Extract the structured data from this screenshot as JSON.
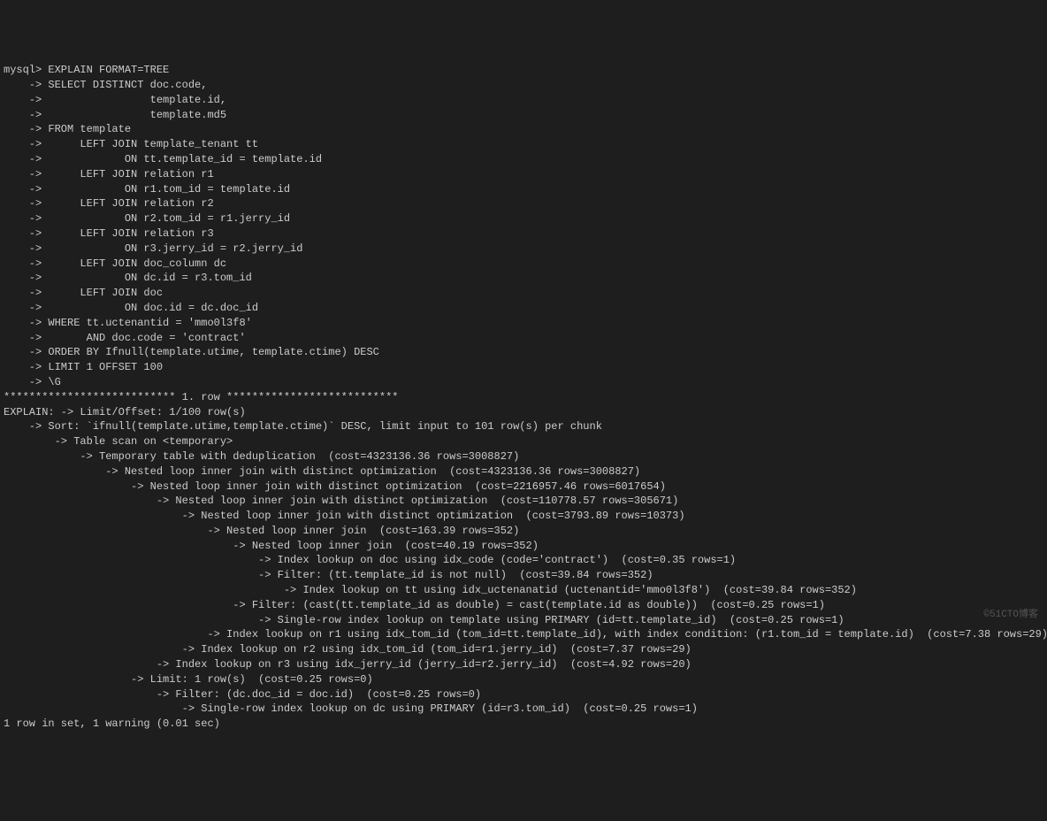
{
  "terminal": {
    "lines": [
      "mysql> EXPLAIN FORMAT=TREE",
      "    -> SELECT DISTINCT doc.code,",
      "    ->                 template.id,",
      "    ->                 template.md5",
      "    -> FROM template",
      "    ->      LEFT JOIN template_tenant tt",
      "    ->             ON tt.template_id = template.id",
      "    ->      LEFT JOIN relation r1",
      "    ->             ON r1.tom_id = template.id",
      "    ->      LEFT JOIN relation r2",
      "    ->             ON r2.tom_id = r1.jerry_id",
      "    ->      LEFT JOIN relation r3",
      "    ->             ON r3.jerry_id = r2.jerry_id",
      "    ->      LEFT JOIN doc_column dc",
      "    ->             ON dc.id = r3.tom_id",
      "    ->      LEFT JOIN doc",
      "    ->             ON doc.id = dc.doc_id",
      "    -> WHERE tt.uctenantid = 'mmo0l3f8'",
      "    ->       AND doc.code = 'contract'",
      "    -> ORDER BY Ifnull(template.utime, template.ctime) DESC",
      "    -> LIMIT 1 OFFSET 100",
      "    -> \\G",
      "*************************** 1. row ***************************",
      "EXPLAIN: -> Limit/Offset: 1/100 row(s)",
      "    -> Sort: `ifnull(template.utime,template.ctime)` DESC, limit input to 101 row(s) per chunk",
      "        -> Table scan on <temporary>",
      "            -> Temporary table with deduplication  (cost=4323136.36 rows=3008827)",
      "                -> Nested loop inner join with distinct optimization  (cost=4323136.36 rows=3008827)",
      "                    -> Nested loop inner join with distinct optimization  (cost=2216957.46 rows=6017654)",
      "                        -> Nested loop inner join with distinct optimization  (cost=110778.57 rows=305671)",
      "                            -> Nested loop inner join with distinct optimization  (cost=3793.89 rows=10373)",
      "                                -> Nested loop inner join  (cost=163.39 rows=352)",
      "                                    -> Nested loop inner join  (cost=40.19 rows=352)",
      "                                        -> Index lookup on doc using idx_code (code='contract')  (cost=0.35 rows=1)",
      "                                        -> Filter: (tt.template_id is not null)  (cost=39.84 rows=352)",
      "                                            -> Index lookup on tt using idx_uctenanatid (uctenantid='mmo0l3f8')  (cost=39.84 rows=352)",
      "                                    -> Filter: (cast(tt.template_id as double) = cast(template.id as double))  (cost=0.25 rows=1)",
      "                                        -> Single-row index lookup on template using PRIMARY (id=tt.template_id)  (cost=0.25 rows=1)",
      "                                -> Index lookup on r1 using idx_tom_id (tom_id=tt.template_id), with index condition: (r1.tom_id = template.id)  (cost=7.38 rows=29)",
      "                            -> Index lookup on r2 using idx_tom_id (tom_id=r1.jerry_id)  (cost=7.37 rows=29)",
      "                        -> Index lookup on r3 using idx_jerry_id (jerry_id=r2.jerry_id)  (cost=4.92 rows=20)",
      "                    -> Limit: 1 row(s)  (cost=0.25 rows=0)",
      "                        -> Filter: (dc.doc_id = doc.id)  (cost=0.25 rows=0)",
      "                            -> Single-row index lookup on dc using PRIMARY (id=r3.tom_id)  (cost=0.25 rows=1)",
      "",
      "1 row in set, 1 warning (0.01 sec)"
    ]
  },
  "watermark": "©51CTO博客"
}
